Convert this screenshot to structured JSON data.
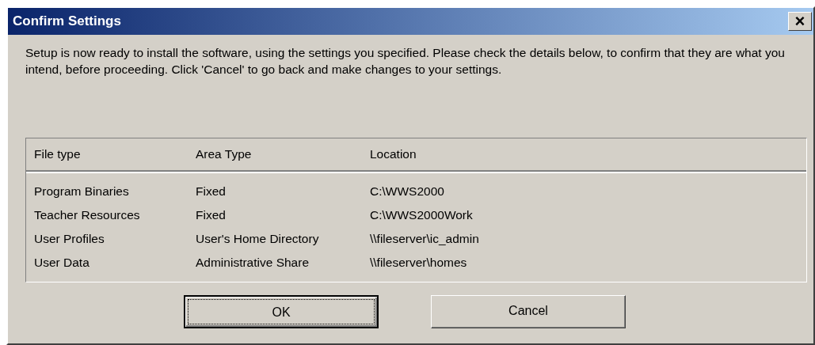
{
  "window": {
    "title": "Confirm Settings",
    "close": "×"
  },
  "message": "Setup is now ready to install the software, using the settings you specified. Please check the details below, to confirm that they are what you intend, before proceeding. Click 'Cancel' to go back and make changes to your settings.",
  "table": {
    "columns": [
      "File type",
      "Area Type",
      "Location"
    ],
    "rows": [
      {
        "cells": [
          "Program Binaries",
          "Fixed",
          "C:\\WWS2000"
        ]
      },
      {
        "cells": [
          "Teacher Resources",
          "Fixed",
          "C:\\WWS2000Work"
        ]
      },
      {
        "cells": [
          "User Profiles",
          "User's Home Directory",
          "\\\\fileserver\\ic_admin"
        ]
      },
      {
        "cells": [
          "User Data",
          "Administrative Share",
          "\\\\fileserver\\homes"
        ]
      }
    ]
  },
  "buttons": [
    {
      "label": "OK",
      "default": true
    },
    {
      "label": "Cancel",
      "default": false
    }
  ]
}
